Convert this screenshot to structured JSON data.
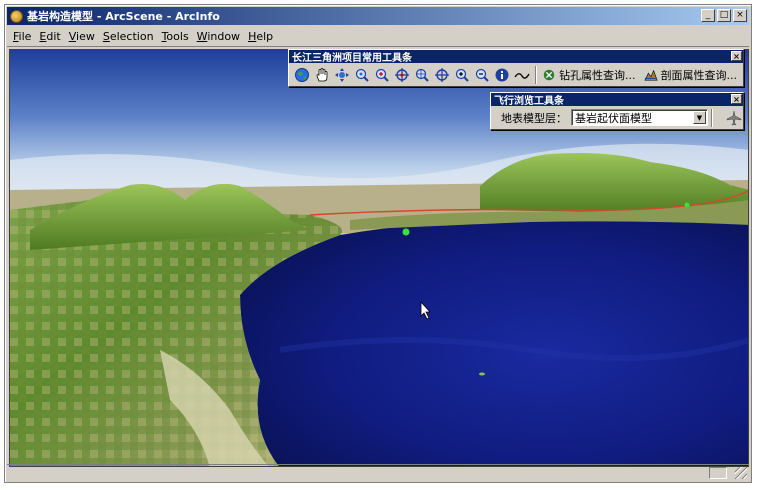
{
  "window": {
    "title": "基岩构造模型 - ArcScene - ArcInfo"
  },
  "caption_buttons": {
    "minimize": "_",
    "maximize": "□",
    "close": "×"
  },
  "menu": [
    "File",
    "Edit",
    "View",
    "Selection",
    "Tools",
    "Window",
    "Help"
  ],
  "toolbar_main": {
    "title": "长江三角洲项目常用工具条",
    "close": "×",
    "tools": [
      "globe-icon",
      "pan-hand-icon",
      "navigate-icon",
      "zoom-extent-icon",
      "zoom-in-out-icon",
      "target-icon",
      "zoom-to-target-icon",
      "center-target-icon",
      "zoom-in-icon",
      "zoom-out-icon",
      "identify-icon",
      "measure-line-icon"
    ],
    "drill_label": "钻孔属性查询...",
    "section_label": "剖面属性查询..."
  },
  "toolbar_fly": {
    "title": "飞行浏览工具条",
    "close": "×",
    "layer_label": "地表模型层：",
    "layer_value": "基岩起伏面模型",
    "dropdown_arrow": "▼"
  },
  "colors": {
    "title_active": "#0a246a",
    "chrome": "#d4d0c8",
    "water": "#0f1a72",
    "sky": "#3b5fb8"
  }
}
